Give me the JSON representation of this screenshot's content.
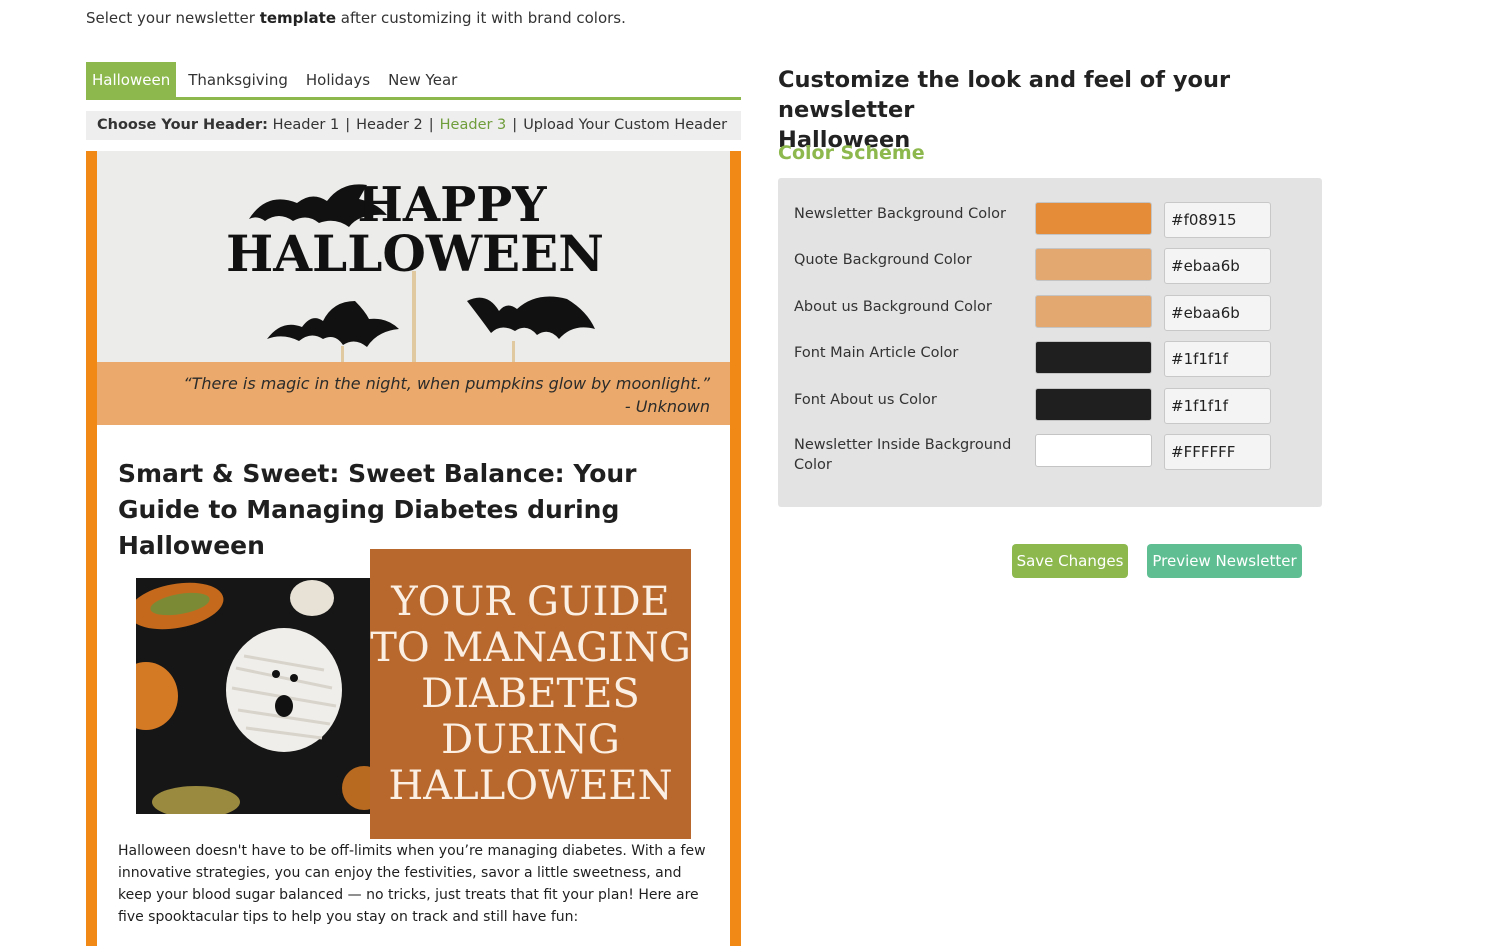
{
  "intro": {
    "prefix": "Select your newsletter ",
    "bold": "template",
    "suffix": " after customizing it with brand colors."
  },
  "tabs": [
    {
      "label": "Halloween",
      "active": true
    },
    {
      "label": "Thanksgiving",
      "active": false
    },
    {
      "label": "Holidays",
      "active": false
    },
    {
      "label": "New Year",
      "active": false
    }
  ],
  "header_choice": {
    "label": "Choose Your Header:",
    "options": [
      "Header 1",
      "Header 2",
      "Header 3",
      "Upload Your Custom Header"
    ],
    "selected": "Header 3",
    "separator": "|"
  },
  "newsletter": {
    "header_image_text": [
      "HAPPY",
      "HALLOWEEN"
    ],
    "quote": "“There is magic in the night, when pumpkins glow by moonlight.” - Unknown",
    "article_title": "Smart & Sweet: Sweet Balance: Your Guide to Managing Diabetes during Halloween",
    "guide_text": [
      "YOUR GUIDE",
      "TO MANAGING",
      "DIABETES",
      "DURING",
      "HALLOWEEN"
    ],
    "body": "Halloween doesn't have to be off-limits when you’re managing diabetes. With a few innovative strategies, you can enjoy the festivities, savor a little sweetness, and keep your blood sugar balanced — no tricks, just treats that fit your plan! Here are five spooktacular tips to help you stay on track and still have fun:"
  },
  "customize": {
    "title_line1": "Customize the look and feel of your newsletter",
    "title_line2": "Halloween",
    "scheme_title": "Color Scheme"
  },
  "colors": [
    {
      "label": "Newsletter Background Color",
      "hex": "#f08915",
      "swatch": "#e48c38"
    },
    {
      "label": "Quote Background Color",
      "hex": "#ebaa6b",
      "swatch": "#e2a86f"
    },
    {
      "label": "About us Background Color",
      "hex": "#ebaa6b",
      "swatch": "#e2a86f"
    },
    {
      "label": "Font Main Article Color",
      "hex": "#1f1f1f",
      "swatch": "#1f1f1f"
    },
    {
      "label": "Font About us Color",
      "hex": "#1f1f1f",
      "swatch": "#1f1f1f"
    },
    {
      "label": "Newsletter Inside Background Color",
      "hex": "#FFFFFF",
      "swatch": "#ffffff"
    }
  ],
  "buttons": {
    "save": "Save Changes",
    "preview": "Preview Newsletter"
  }
}
